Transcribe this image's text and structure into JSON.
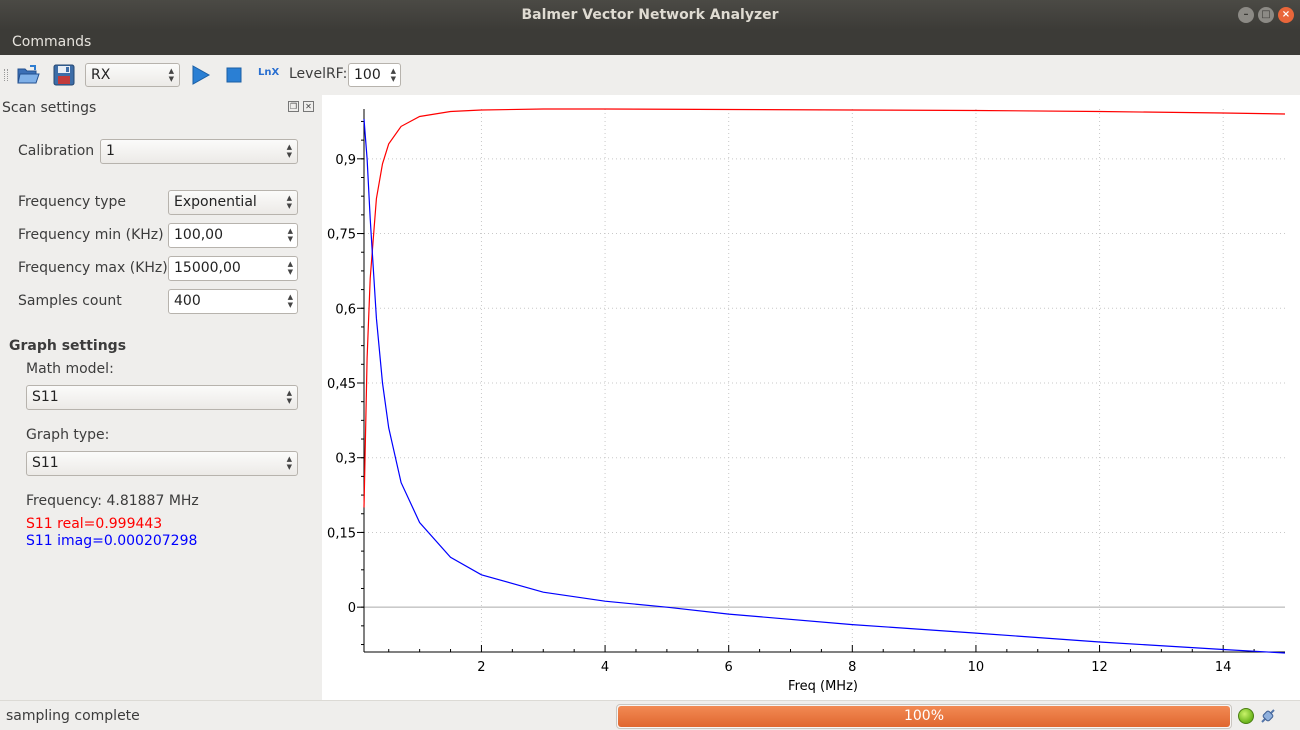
{
  "window": {
    "title": "Balmer Vector Network Analyzer",
    "btn_minimize": "–",
    "btn_maximize": "□",
    "btn_close": "×"
  },
  "menu": {
    "commands": "Commands"
  },
  "toolbar": {
    "mode_value": "RX",
    "lnx_label": "LnX",
    "level_label": "LevelRF:",
    "level_value": "100",
    "icons": [
      "open-folder-icon",
      "save-disk-icon",
      "play-icon",
      "stop-icon",
      "lnx-icon"
    ]
  },
  "scan_settings": {
    "title": "Scan settings",
    "calibration_label": "Calibration",
    "calibration_value": "1",
    "freq_type_label": "Frequency type",
    "freq_type_value": "Exponential",
    "freq_min_label": "Frequency min (KHz)",
    "freq_min_value": "100,00",
    "freq_max_label": "Frequency max (KHz)",
    "freq_max_value": "15000,00",
    "samples_label": "Samples count",
    "samples_value": "400"
  },
  "graph_settings": {
    "title": "Graph settings",
    "math_model_label": "Math model:",
    "math_model_value": "S11",
    "graph_type_label": "Graph type:",
    "graph_type_value": "S11",
    "frequency_readout": "Frequency: 4.81887 MHz",
    "real_readout": "S11 real=0.999443",
    "imag_readout": "S11 imag=0.000207298"
  },
  "status": {
    "text": "sampling complete",
    "progress": 100,
    "progress_label": "100%"
  },
  "colors": {
    "real": "#ff0000",
    "imag": "#0000ff",
    "progress": "#e8733c",
    "titlebar": "#3c3b37"
  },
  "chart_data": {
    "type": "line",
    "title": "",
    "xlabel": "Freq (MHz)",
    "ylabel": "",
    "xlim": [
      0.1,
      15
    ],
    "ylim": [
      -0.09,
      1.0
    ],
    "x_ticks": [
      {
        "v": 2,
        "label": "2"
      },
      {
        "v": 4,
        "label": "4"
      },
      {
        "v": 6,
        "label": "6"
      },
      {
        "v": 8,
        "label": "8"
      },
      {
        "v": 10,
        "label": "10"
      },
      {
        "v": 12,
        "label": "12"
      },
      {
        "v": 14,
        "label": "14"
      }
    ],
    "y_ticks": [
      {
        "v": 0,
        "label": "0"
      },
      {
        "v": 0.15,
        "label": "0,15"
      },
      {
        "v": 0.3,
        "label": "0,3"
      },
      {
        "v": 0.45,
        "label": "0,45"
      },
      {
        "v": 0.6,
        "label": "0,6"
      },
      {
        "v": 0.75,
        "label": "0,75"
      },
      {
        "v": 0.9,
        "label": "0,9"
      }
    ],
    "grid": true,
    "series": [
      {
        "name": "S11 real",
        "color": "#ff0000",
        "x": [
          0.1,
          0.15,
          0.2,
          0.3,
          0.4,
          0.5,
          0.7,
          1.0,
          1.5,
          2.0,
          3.0,
          4.0,
          6.0,
          8.0,
          10.0,
          12.0,
          14.0,
          15.0
        ],
        "y": [
          0.2,
          0.5,
          0.66,
          0.82,
          0.89,
          0.93,
          0.965,
          0.985,
          0.995,
          0.998,
          1.0,
          1.0,
          0.999,
          0.998,
          0.997,
          0.995,
          0.992,
          0.99
        ]
      },
      {
        "name": "S11 imag",
        "color": "#0000ff",
        "x": [
          0.1,
          0.15,
          0.2,
          0.3,
          0.4,
          0.5,
          0.7,
          1.0,
          1.5,
          2.0,
          3.0,
          4.0,
          5.0,
          6.0,
          8.0,
          10.0,
          12.0,
          14.0,
          15.0
        ],
        "y": [
          0.98,
          0.9,
          0.78,
          0.58,
          0.45,
          0.36,
          0.25,
          0.17,
          0.1,
          0.065,
          0.03,
          0.012,
          0.0,
          -0.014,
          -0.035,
          -0.052,
          -0.07,
          -0.085,
          -0.092
        ]
      }
    ]
  }
}
